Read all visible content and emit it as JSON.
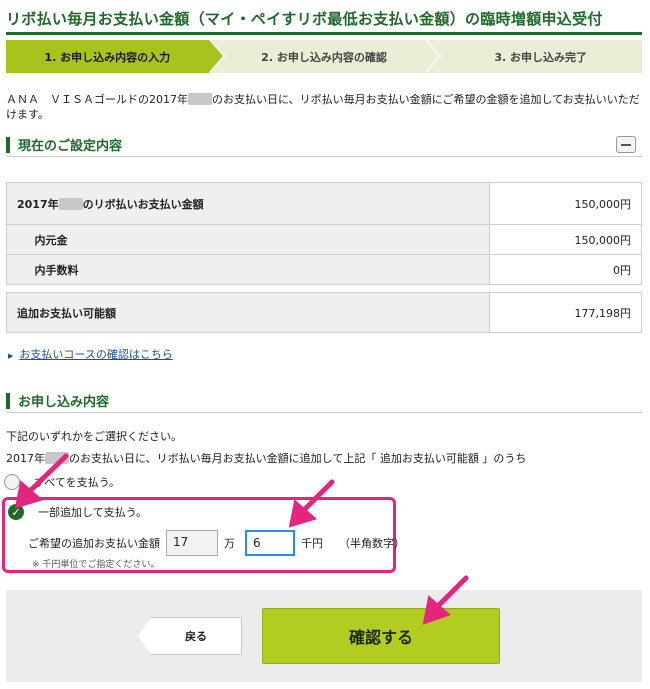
{
  "page_title": "リボ払い毎月お支払い金額（マイ・ペイすリボ最低お支払い金額）の臨時増額申込受付",
  "steps": [
    {
      "label": "1. お申し込み内容の入力",
      "active": true
    },
    {
      "label": "2. お申し込み内容の確認",
      "active": false
    },
    {
      "label": "3. お申し込み完了",
      "active": false
    }
  ],
  "intro": {
    "part1": "ＡＮＡ　ＶＩＳＡゴールドの2017年",
    "part2": "のお支払い日に、リボ払い毎月お支払い金額にご希望の金額を追加してお支払いいただけます。"
  },
  "current_settings": {
    "heading": "現在のご設定内容",
    "revo_label_prefix": "2017年",
    "revo_label_suffix": "のリボ払いお支払い金額",
    "revo_amount": "150,000円",
    "principal_label": "内元金",
    "principal_amount": "150,000円",
    "fee_label": "内手数料",
    "fee_amount": "0円",
    "available_label": "追加お支払い可能額",
    "available_amount": "177,198円"
  },
  "course_link": "お支払いコースの確認はこちら",
  "application": {
    "heading": "お申し込み内容",
    "instruction": "下記のいずれかをご選択ください。",
    "instruction2_prefix": "2017年",
    "instruction2_suffix": "のお支払い日に、リボ払い毎月お支払い金額に追加して上記「 追加お支払い可能額 」のうち",
    "option_all": "すべてを支払う。",
    "option_partial": "一部追加して支払う。",
    "amount_label": "ご希望の追加お支払い金額",
    "man_value": "17",
    "man_unit": "万",
    "sen_value": "6",
    "sen_unit": "千円",
    "hint": "（半角数字）",
    "note": "※ 千円単位でご指定ください。"
  },
  "buttons": {
    "back": "戻る",
    "confirm": "確認する"
  },
  "colors": {
    "brand_green": "#1f6a2a",
    "step_active": "#a8c31e",
    "confirm_button": "#b3cc22",
    "annotation_pink": "#e4257d",
    "input_focus": "#2c8ee8"
  }
}
